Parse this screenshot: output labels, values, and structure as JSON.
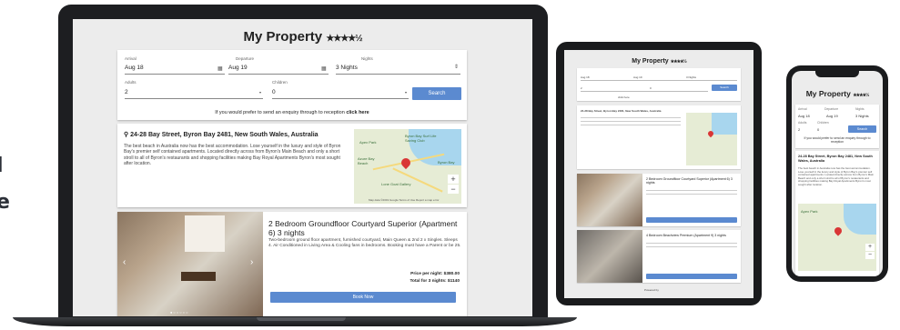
{
  "background_text": {
    "line1": "l",
    "line2": "e"
  },
  "property": {
    "title": "My Property",
    "stars": "★★★★½",
    "address": "24-28 Bay Street, Byron Bay 2481, New South Wales, Australia",
    "description": "The best beach in Australia now has the best accommodation. Lose yourself in the luxury and style of Byron Bay's premier self contained apartments. Located directly across from Byron's Main Beach and only a short stroll to all of Byron's restaurants and shopping facilities making Bay Royal Apartments Byron's most sought after location."
  },
  "search_form": {
    "arrival_label": "Arrival",
    "arrival_value": "Aug 18",
    "departure_label": "Departure",
    "departure_value": "Aug 19",
    "nights_label": "Nights",
    "nights_value": "3 Nights",
    "adults_label": "Adults",
    "adults_value": "2",
    "children_label": "Children",
    "children_value": "0",
    "search_label": "Search",
    "enquiry_prefix": "If you would prefer to send an enquiry through to reception",
    "enquiry_link": "click here"
  },
  "map": {
    "labels": [
      "Apex Park",
      "Byron Bay Surf Life Saving Club",
      "Byron Beach",
      "Byron Bay",
      "Azure Bay Beach",
      "Lone Goat Gallery"
    ],
    "footer": "Map data ©2019 Google   Terms of Use   Report a map error"
  },
  "rooms": [
    {
      "title": "2 Bedroom Groundfloor Courtyard Superior (Apartment 6) 3 nights",
      "description": "Two-bedroom ground floor apartment, furnished courtyard, Main Queen & 2nd 2 x Singles. Sleeps 4. Air Conditioned in Living Area & Cooling fans in bedrooms. Booking must have a Parent or be 25.",
      "price_per_night": "Price per night: $380.00",
      "total": "Total for 3 nights: $1140",
      "book_label": "Book Now"
    }
  ],
  "tablet": {
    "room2_title": "2 Bedroom Groundfloor Courtyard Superior (Apartment 6) 3 nights",
    "room3_title": "4 Bedroom Beachview Premium (Apartment 9) 3 nights",
    "footer": "Powered by"
  },
  "phone": {
    "nights_value": "3 Nights",
    "arrival_value": "Aug 18",
    "departure_value": "Aug 19",
    "adults_value": "2",
    "children_value": "0"
  }
}
